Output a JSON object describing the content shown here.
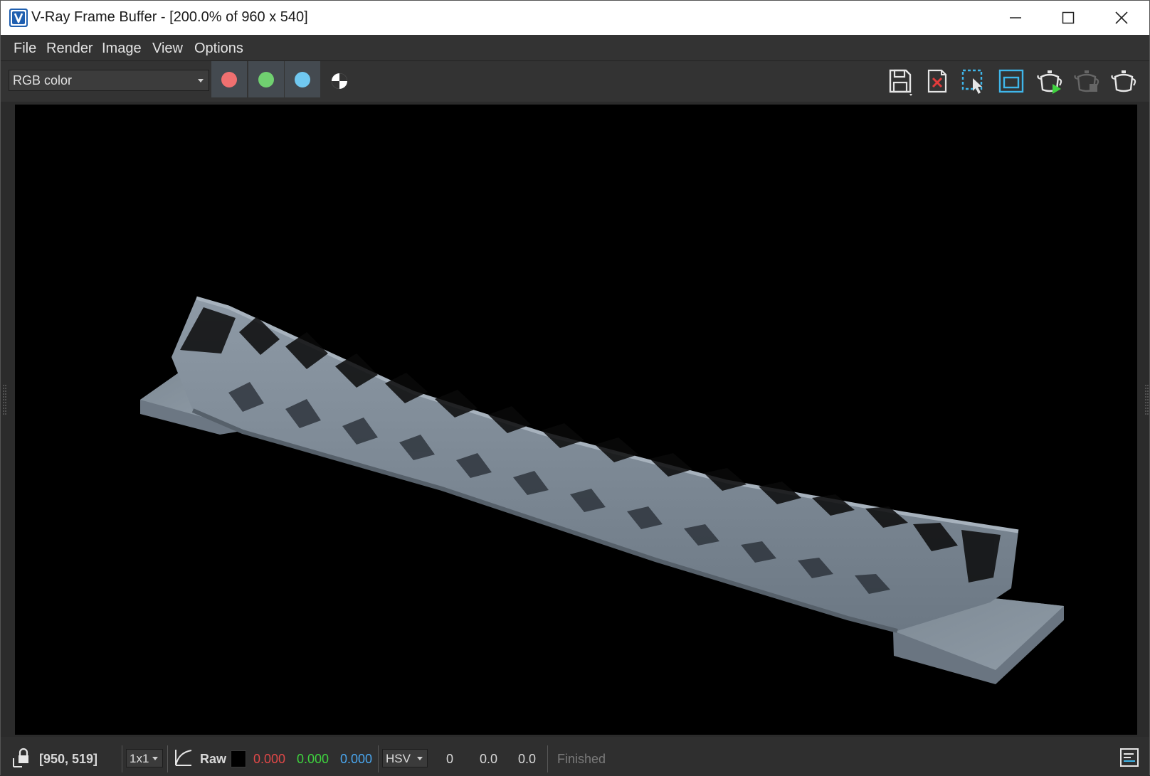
{
  "window": {
    "title": "V-Ray Frame Buffer - [200.0% of 960 x 540]",
    "app_icon": "vray-logo-icon",
    "controls": [
      "minimize-icon",
      "maximize-icon",
      "close-icon"
    ]
  },
  "menu": {
    "items": [
      "File",
      "Render",
      "Image",
      "View",
      "Options"
    ]
  },
  "toolbar": {
    "channel_select": "RGB color",
    "channel_buttons": [
      {
        "name": "red-channel",
        "color": "#f07070"
      },
      {
        "name": "green-channel",
        "color": "#70d070"
      },
      {
        "name": "blue-channel",
        "color": "#70c8f0"
      }
    ],
    "alpha_icon": "alpha-channel-icon",
    "right_icons": [
      "save-image-icon",
      "clear-image-icon",
      "track-mouse-icon",
      "region-render-icon",
      "render-interactive-icon",
      "stop-render-icon",
      "render-icon"
    ]
  },
  "viewport": {
    "image": "rendered-lattice-bridge",
    "background": "#000000"
  },
  "statusbar": {
    "coords": "[950, 519]",
    "sample_size": "1x1",
    "raw_label": "Raw",
    "r": "0.000",
    "g": "0.000",
    "b": "0.000",
    "color_mode": "HSV",
    "h": "0",
    "s": "0.0",
    "v": "0.0",
    "status": "Finished",
    "colors": {
      "r": "#e04848",
      "g": "#3ed23e",
      "b": "#4aa6ee",
      "muted": "#7a7a7a"
    }
  }
}
